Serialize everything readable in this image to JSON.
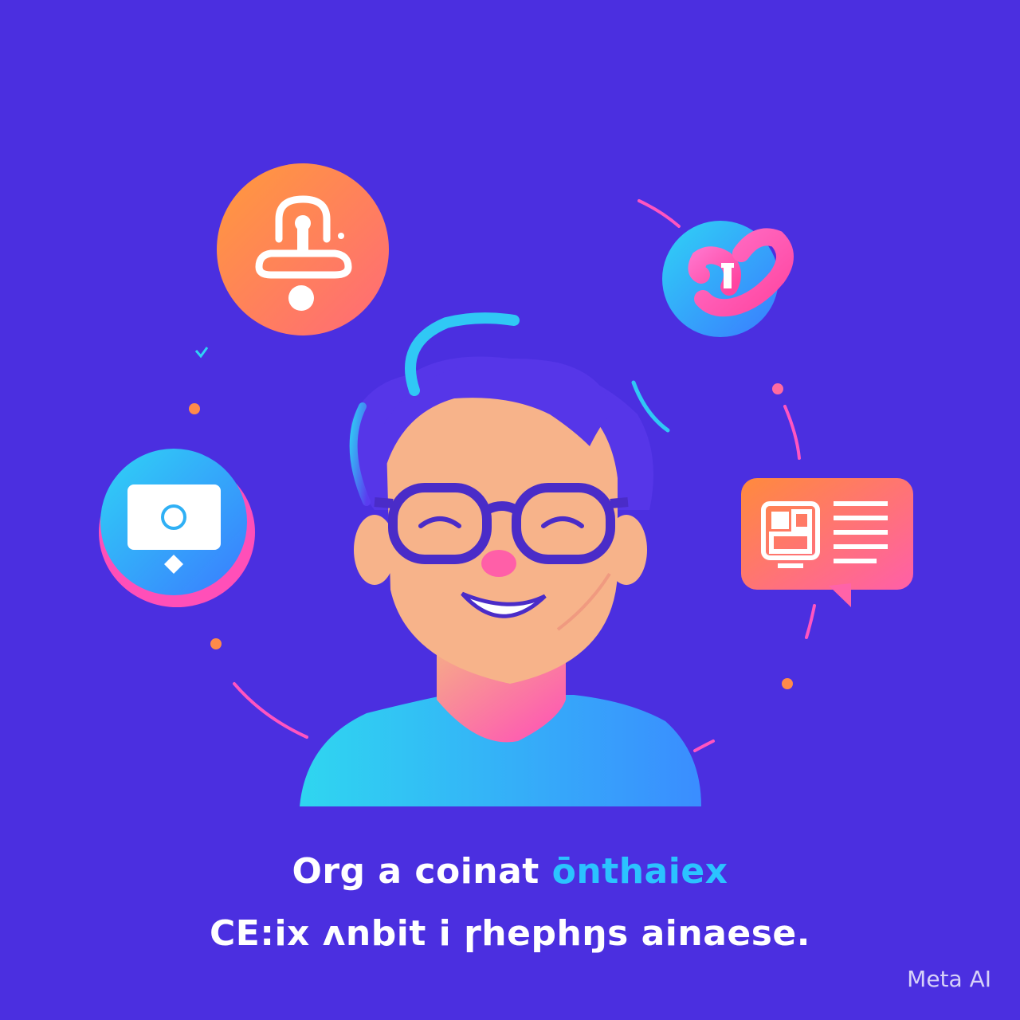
{
  "caption": {
    "line1_part1": "Org a coinat ",
    "line1_part2": "ōnthaiex",
    "line2": "CE:ix ʌnbit i  ɼhephŋs ainaese."
  },
  "watermark": "Meta AI",
  "colors": {
    "background": "#4b2fe0",
    "orange": "#ff8a4a",
    "pink": "#ff4fb8",
    "cyan": "#27c4f4",
    "skin": "#f7b38a",
    "glasses": "#4a2cc8"
  },
  "icons": [
    "lock-icon",
    "link-icon",
    "monitor-icon",
    "chat-bubble-icon"
  ]
}
